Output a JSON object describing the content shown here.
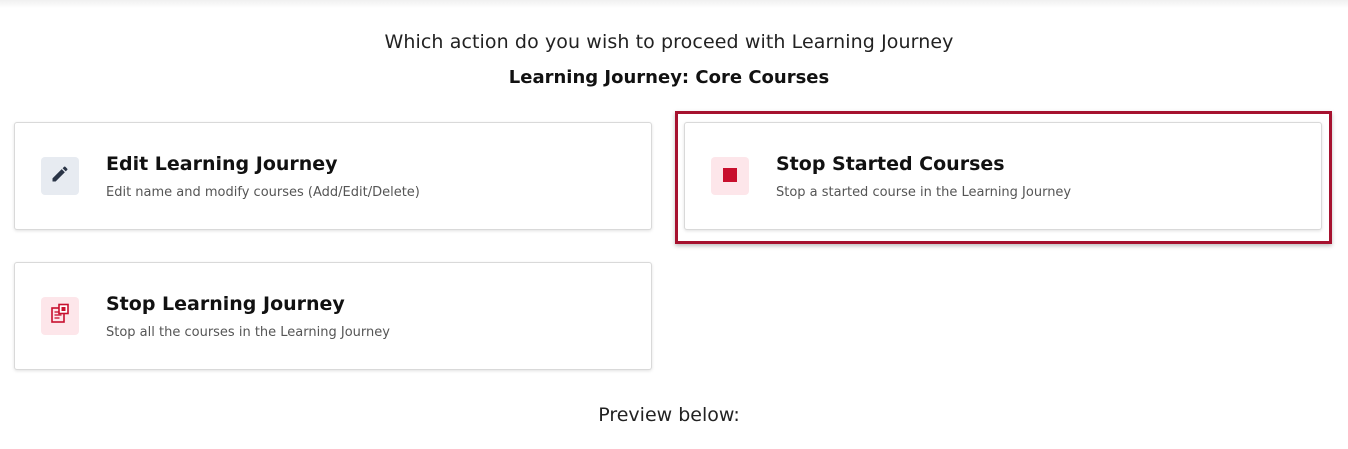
{
  "prompt": {
    "question": "Which action do you wish to proceed with Learning Journey",
    "subtitle": "Learning Journey: Core Courses"
  },
  "actions": [
    {
      "title": "Edit Learning Journey",
      "description": "Edit name and modify courses (Add/Edit/Delete)",
      "icon": "pencil-icon"
    },
    {
      "title": "Stop Started Courses",
      "description": "Stop a started course in the Learning Journey",
      "icon": "stop-square-icon",
      "highlighted": true
    },
    {
      "title": "Stop Learning Journey",
      "description": "Stop all the courses in the Learning Journey",
      "icon": "stop-journey-icon"
    }
  ],
  "preview": {
    "label": "Preview below:"
  },
  "colors": {
    "highlight_border": "#a6122f",
    "stop_icon": "#c8102e",
    "edit_icon": "#2a3446",
    "stop_icon_bg": "#fde6ea",
    "edit_icon_bg": "#e7ebf1"
  }
}
